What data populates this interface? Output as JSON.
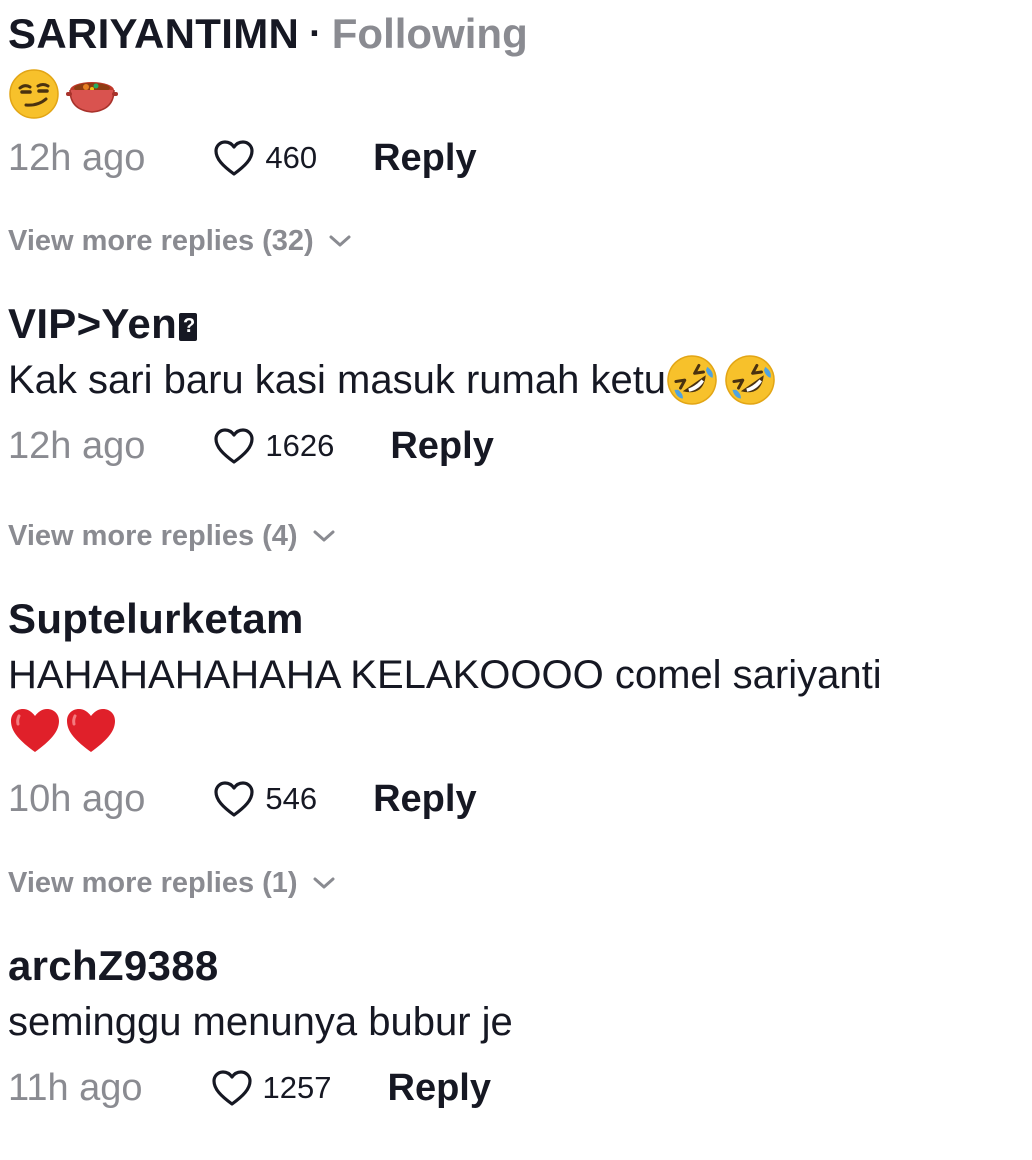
{
  "comments": [
    {
      "username": "SARIYANTIMN",
      "separator": "·",
      "following": "Following",
      "emojis": [
        "smirking-face",
        "pot-of-food"
      ],
      "time": "12h ago",
      "likes": "460",
      "reply": "Reply",
      "view_more": "View more replies (32)"
    },
    {
      "username": "VIP>Yen",
      "text": "Kak sari baru kasi masuk rumah ketu",
      "emojis": [
        "rolling-on-floor-laughing",
        "rolling-on-floor-laughing"
      ],
      "time": "12h ago",
      "likes": "1626",
      "reply": "Reply",
      "view_more": "View more replies (4)"
    },
    {
      "username": "Suptelurketam",
      "text": "HAHAHAHAHAHA KELAKOOOO comel sariyanti",
      "emojis": [
        "red-heart",
        "red-heart"
      ],
      "time": "10h ago",
      "likes": "546",
      "reply": "Reply",
      "view_more": "View more replies (1)"
    },
    {
      "username": "archZ9388",
      "text": "seminggu menunya bubur je",
      "time": "11h ago",
      "likes": "1257",
      "reply": "Reply"
    }
  ],
  "colors": {
    "primary_text": "#161823",
    "secondary_text": "#8a8b91",
    "background": "#ffffff"
  }
}
